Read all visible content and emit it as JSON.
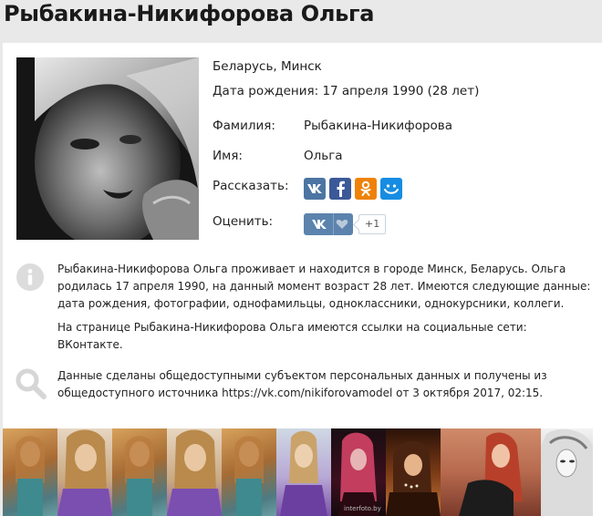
{
  "profile": {
    "name": "Рыбакина-Никифорова Ольга",
    "location": "Беларусь, Минск",
    "birth": "Дата рождения: 17 апреля 1990 (28 лет)",
    "surname_label": "Фамилия:",
    "surname_value": "Рыбакина-Никифорова",
    "firstname_label": "Имя:",
    "firstname_value": "Ольга",
    "share_label": "Рассказать:",
    "rate_label": "Оценить:",
    "rate_count": "+1",
    "rate_vk": "VK"
  },
  "share_buttons": [
    {
      "name": "vk",
      "color": "#4c75a3",
      "glyph": "VK"
    },
    {
      "name": "facebook",
      "color": "#3b5998",
      "glyph": "f"
    },
    {
      "name": "odnoklassniki",
      "color": "#ee8208",
      "glyph": "ok"
    },
    {
      "name": "moimir",
      "color": "#168de2",
      "glyph": "mm"
    }
  ],
  "description": {
    "p1": "Рыбакина-Никифорова Ольга проживает и находится в городе Минск, Беларусь. Ольга родилась 17 апреля 1990, на данный момент возраст 28 лет. Имеются следующие данные: дата рождения, фотографии, однофамильцы, одноклассники, однокурсники, коллеги.",
    "p2": "На странице Рыбакина-Никифорова Ольга имеются ссылки на социальные сети: ВКонтакте.",
    "p3": "Данные сделаны общедоступными субъектом персональных данных и получены из общедоступного источника https://vk.com/nikiforovamodel от 3 октября 2017, 02:15."
  },
  "gallery": {
    "watermark": "interfoto.by"
  }
}
